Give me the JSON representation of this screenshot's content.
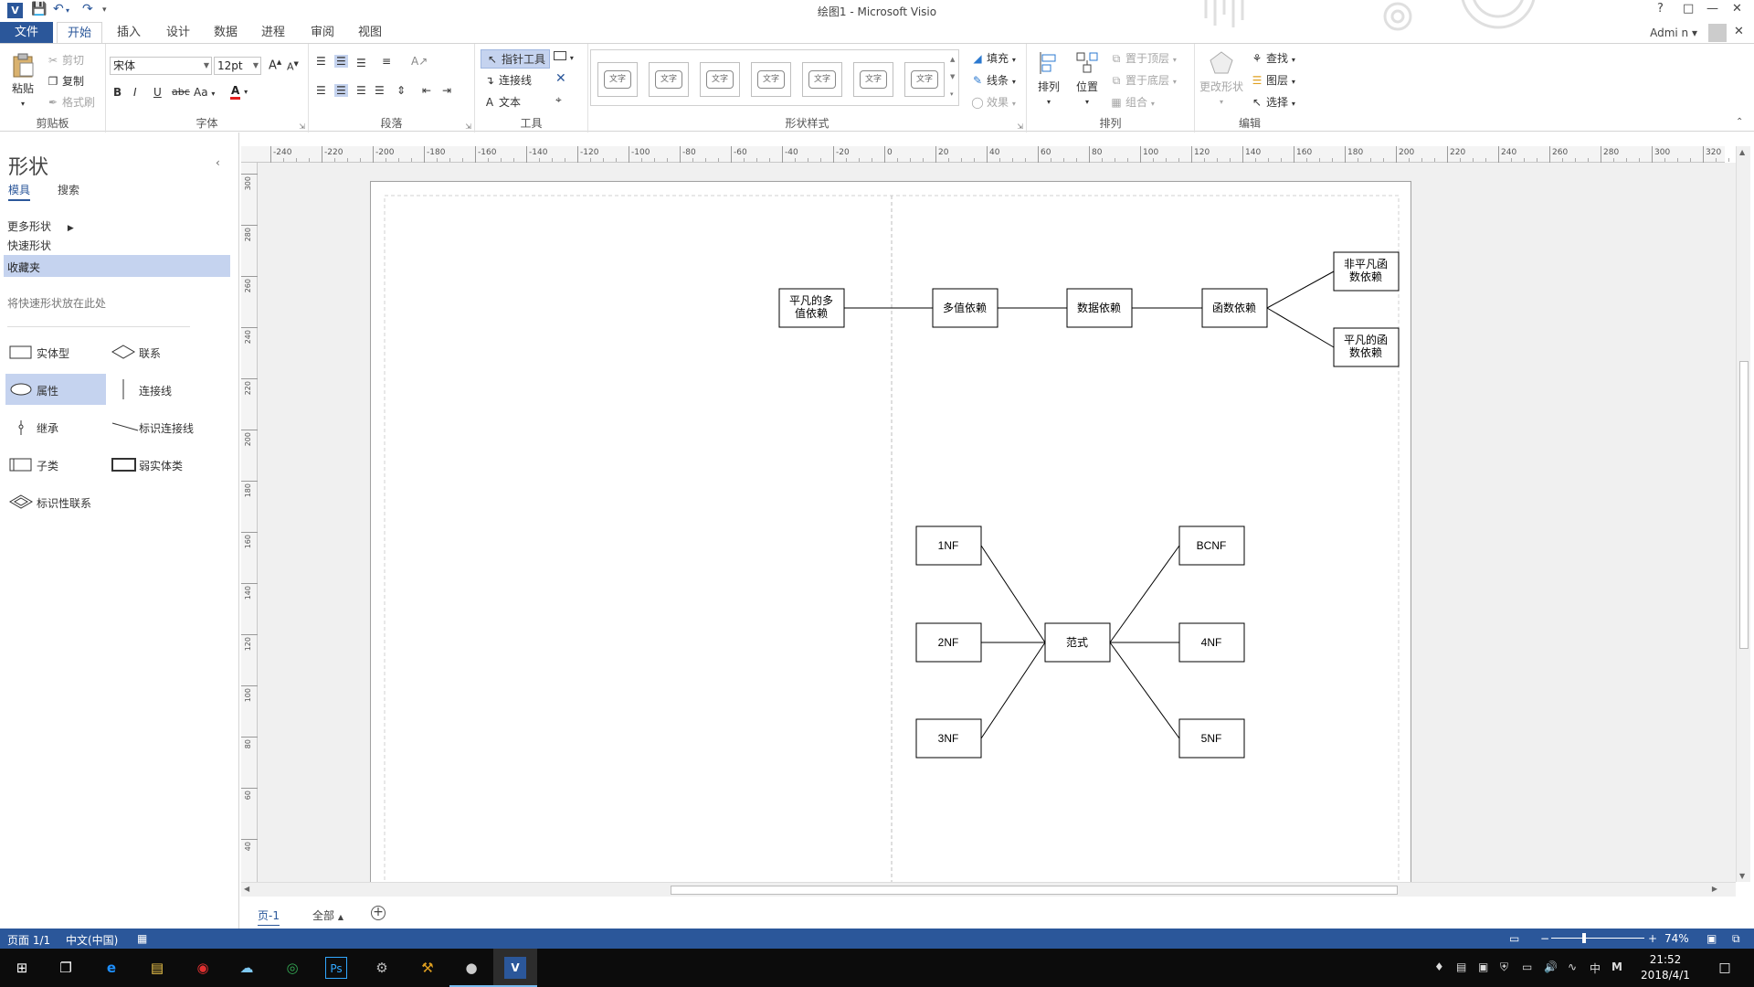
{
  "window": {
    "title": "绘图1 - Microsoft Visio",
    "help": "?",
    "user": "Admi n"
  },
  "tabs": [
    "文件",
    "开始",
    "插入",
    "设计",
    "数据",
    "进程",
    "审阅",
    "视图"
  ],
  "ribbon": {
    "clipboard": {
      "paste": "粘贴",
      "cut": "剪切",
      "copy": "复制",
      "format_painter": "格式刷",
      "label": "剪贴板"
    },
    "font": {
      "name": "宋体",
      "size": "12pt",
      "label": "字体",
      "bold": "B",
      "italic": "I",
      "underline": "U",
      "strike": "abc",
      "case": "Aa"
    },
    "paragraph": {
      "label": "段落"
    },
    "tools": {
      "pointer": "指针工具",
      "connector": "连接线",
      "text": "文本",
      "label": "工具"
    },
    "shape_styles": {
      "style_text": "文字",
      "fill": "填充",
      "line": "线条",
      "effect": "效果",
      "label": "形状样式"
    },
    "arrange": {
      "align": "排列",
      "position": "位置",
      "bring_front": "置于顶层",
      "send_back": "置于底层",
      "group": "组合",
      "label": "排列"
    },
    "editing": {
      "change_shape": "更改形状",
      "find": "查找",
      "layers": "图层",
      "select": "选择",
      "label": "编辑"
    }
  },
  "shapes_pane": {
    "title": "形状",
    "tabs": [
      "模具",
      "搜索"
    ],
    "items": [
      "更多形状",
      "快速形状",
      "收藏夹"
    ],
    "drop_hint": "将快速形状放在此处",
    "masters": [
      "实体型",
      "联系",
      "属性",
      "连接线",
      "继承",
      "标识连接线",
      "子类",
      "弱实体类",
      "标识性联系"
    ]
  },
  "rulers": {
    "h_ticks": [
      "-240",
      "-220",
      "-200",
      "-180",
      "-160",
      "-140",
      "-120",
      "-100",
      "-80",
      "-60",
      "-40",
      "-20",
      "0",
      "20",
      "40",
      "60",
      "80",
      "100",
      "120",
      "140",
      "160",
      "180",
      "200",
      "220",
      "240",
      "260",
      "280",
      "300",
      "320"
    ],
    "v_ticks": [
      "300",
      "280",
      "260",
      "240",
      "220",
      "200",
      "180",
      "160",
      "140",
      "120",
      "100",
      "80",
      "60",
      "40"
    ]
  },
  "diagram": {
    "top": [
      "平凡的多值依赖",
      "多值依赖",
      "数据依赖",
      "函数依赖",
      "非平凡函数依赖",
      "平凡的函数依赖"
    ],
    "bottom": [
      "1NF",
      "2NF",
      "3NF",
      "范式",
      "BCNF",
      "4NF",
      "5NF"
    ]
  },
  "page_tabs": {
    "page": "页-1",
    "all": "全部"
  },
  "status": {
    "page": "页面 1/1",
    "lang": "中文(中国)",
    "zoom": "74%"
  },
  "taskbar": {
    "time": "21:52",
    "date": "2018/4/1",
    "ime": "中",
    "ime2": "M"
  }
}
